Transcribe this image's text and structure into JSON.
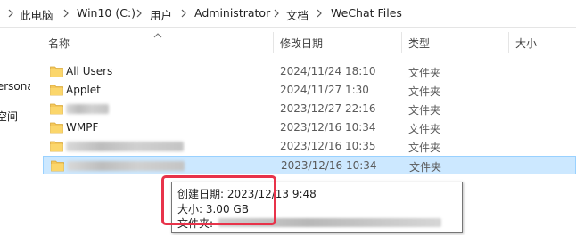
{
  "breadcrumb": [
    "此电脑",
    "Win10 (C:)",
    "用户",
    "Administrator",
    "文档",
    "WeChat Files"
  ],
  "nav": {
    "item1": "Persona",
    "item2": "空间"
  },
  "columns": {
    "name": "名称",
    "modified": "修改日期",
    "type": "类型",
    "size": "大小"
  },
  "rows": [
    {
      "name": "All Users",
      "modified": "2024/11/24 18:10",
      "type": "文件夹",
      "selected": false,
      "blurred": false
    },
    {
      "name": "Applet",
      "modified": "2024/11/27 1:30",
      "type": "文件夹",
      "selected": false,
      "blurred": false
    },
    {
      "name": "",
      "modified": "2023/12/27 22:16",
      "type": "文件夹",
      "selected": false,
      "blurred": true
    },
    {
      "name": "WMPF",
      "modified": "2023/12/16 10:34",
      "type": "文件夹",
      "selected": false,
      "blurred": false
    },
    {
      "name": "",
      "modified": "2023/12/16 10:35",
      "type": "文件夹",
      "selected": false,
      "blurred": true
    },
    {
      "name": "",
      "modified": "2023/12/16 10:34",
      "type": "文件夹",
      "selected": true,
      "blurred": true
    }
  ],
  "tooltip": {
    "created": "创建日期: 2023/12/13 9:48",
    "size": "大小: 3.00 GB",
    "folder_label": "文件夹:"
  },
  "colors": {
    "selection": "#cce8ff",
    "highlight_box": "#e8334a",
    "folder": "#f5c85a"
  }
}
